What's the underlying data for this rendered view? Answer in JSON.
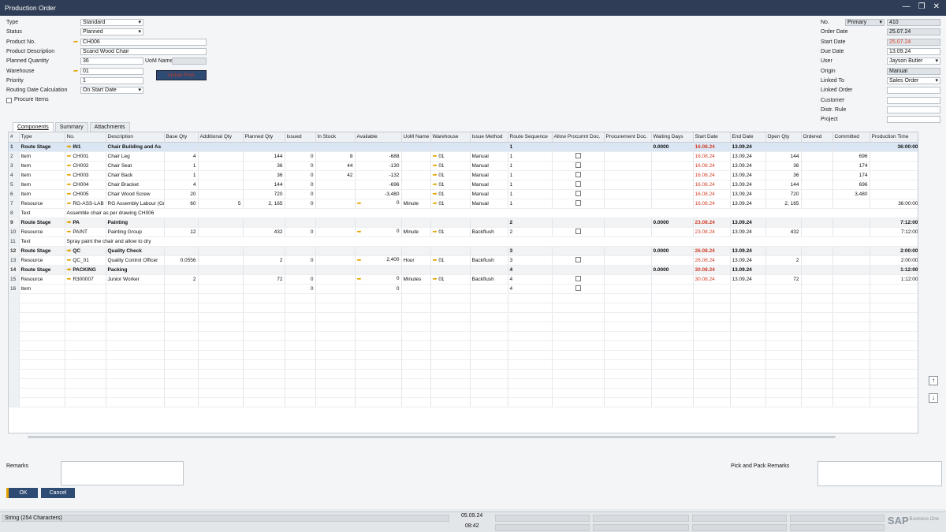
{
  "window": {
    "title": "Production Order"
  },
  "header": {
    "type": {
      "label": "Type",
      "value": "Standard"
    },
    "status": {
      "label": "Status",
      "value": "Planned"
    },
    "product_no": {
      "label": "Product No.",
      "value": "CH006"
    },
    "product_desc": {
      "label": "Product Description",
      "value": "Scand Wood Chair"
    },
    "planned_qty": {
      "label": "Planned Quantity",
      "value": "36"
    },
    "uom_name": {
      "label": "UoM Name",
      "value": ""
    },
    "warehouse": {
      "label": "Warehouse",
      "value": "01"
    },
    "priority": {
      "label": "Priority",
      "value": "1"
    },
    "routing_date": {
      "label": "Routing Date Calculation",
      "value": "On Start Date"
    },
    "procure_items": {
      "label": "Procure Items"
    },
    "red_button": {
      "label": "Update Prod."
    },
    "no": {
      "label": "No.",
      "series": "Primary",
      "value": "410"
    },
    "order_date": {
      "label": "Order Date",
      "value": "25.07.24"
    },
    "start_date": {
      "label": "Start Date",
      "value": "25.07.24"
    },
    "due_date": {
      "label": "Due Date",
      "value": "13.09.24"
    },
    "user": {
      "label": "User",
      "value": "Jayson Butler"
    },
    "origin": {
      "label": "Origin",
      "value": "Manual"
    },
    "linked_to": {
      "label": "Linked To",
      "value": "Sales Order"
    },
    "linked_order": {
      "label": "Linked Order",
      "value": ""
    },
    "customer": {
      "label": "Customer",
      "value": ""
    },
    "distr_rule": {
      "label": "Distr. Rule",
      "value": ""
    },
    "project": {
      "label": "Project",
      "value": ""
    }
  },
  "tabs": [
    "Components",
    "Summary",
    "Attachments"
  ],
  "grid": {
    "columns": [
      "#",
      "Type",
      "No.",
      "Description",
      "Base Qty",
      "Additional Qty",
      "Planned Qty",
      "Issued",
      "In Stock",
      "Available",
      "UoM Name",
      "Warehouse",
      "Issue Method",
      "Route Sequence",
      "Allow Procurmt Doc.",
      "Procurement Doc.",
      "Waiting Days",
      "Start Date",
      "End Date",
      "Open Qty",
      "Ordered",
      "Committed",
      "Production Time"
    ],
    "rows": [
      {
        "n": "1",
        "type": "Route Stage",
        "no": "IN1",
        "desc": "Chair Building and As",
        "base": "",
        "add": "",
        "planned": "",
        "issued": "",
        "stock": "",
        "avail": "",
        "uom": "",
        "wh": "",
        "method": "",
        "seq": "1",
        "allow": false,
        "proc": "",
        "wait": "0.0000",
        "start": "16.08.24",
        "end": "13.09.24",
        "open": "",
        "ordered": "",
        "committed": "",
        "time": "36:00:00",
        "kind": "stage first"
      },
      {
        "n": "2",
        "type": "Item",
        "no": "CH001",
        "desc": "Chair Leg",
        "base": "4",
        "add": "",
        "planned": "144",
        "issued": "0",
        "stock": "8",
        "avail": "-688",
        "uom": "",
        "wh": "01",
        "method": "Manual",
        "seq": "1",
        "allow": true,
        "proc": "",
        "wait": "",
        "start": "16.08.24",
        "end": "13.09.24",
        "open": "144",
        "ordered": "",
        "committed": "696",
        "time": "",
        "kind": "item"
      },
      {
        "n": "3",
        "type": "Item",
        "no": "CH002",
        "desc": "Chair Seat",
        "base": "1",
        "add": "",
        "planned": "36",
        "issued": "0",
        "stock": "44",
        "avail": "-130",
        "uom": "",
        "wh": "01",
        "method": "Manual",
        "seq": "1",
        "allow": true,
        "proc": "",
        "wait": "",
        "start": "16.08.24",
        "end": "13.09.24",
        "open": "36",
        "ordered": "",
        "committed": "174",
        "time": "",
        "kind": "item"
      },
      {
        "n": "4",
        "type": "Item",
        "no": "CH003",
        "desc": "Chair Back",
        "base": "1",
        "add": "",
        "planned": "36",
        "issued": "0",
        "stock": "42",
        "avail": "-132",
        "uom": "",
        "wh": "01",
        "method": "Manual",
        "seq": "1",
        "allow": true,
        "proc": "",
        "wait": "",
        "start": "16.08.24",
        "end": "13.09.24",
        "open": "36",
        "ordered": "",
        "committed": "174",
        "time": "",
        "kind": "item"
      },
      {
        "n": "5",
        "type": "Item",
        "no": "CH004",
        "desc": "Chair Bracket",
        "base": "4",
        "add": "",
        "planned": "144",
        "issued": "0",
        "stock": "",
        "avail": "-696",
        "uom": "",
        "wh": "01",
        "method": "Manual",
        "seq": "1",
        "allow": true,
        "proc": "",
        "wait": "",
        "start": "16.08.24",
        "end": "13.09.24",
        "open": "144",
        "ordered": "",
        "committed": "696",
        "time": "",
        "kind": "item"
      },
      {
        "n": "6",
        "type": "Item",
        "no": "CH005",
        "desc": "Chair Wood Screw",
        "base": "20",
        "add": "",
        "planned": "720",
        "issued": "0",
        "stock": "",
        "avail": "-3,480",
        "uom": "",
        "wh": "01",
        "method": "Manual",
        "seq": "1",
        "allow": true,
        "proc": "",
        "wait": "",
        "start": "16.08.24",
        "end": "13.09.24",
        "open": "720",
        "ordered": "",
        "committed": "3,480",
        "time": "",
        "kind": "item"
      },
      {
        "n": "7",
        "type": "Resource",
        "no": "RG-ASS-LAB",
        "desc": "RG Assembly Labour (Gr",
        "base": "60",
        "add": "5",
        "planned": "2, 165",
        "issued": "0",
        "stock": "",
        "avail": "0",
        "uom": "Minute",
        "wh": "01",
        "method": "Manual",
        "seq": "1",
        "allow": true,
        "proc": "",
        "wait": "",
        "start": "16.08.24",
        "end": "13.09.24",
        "open": "2, 165",
        "ordered": "",
        "committed": "",
        "time": "36:00:00",
        "kind": "res"
      },
      {
        "n": "8",
        "type": "Text",
        "no": "",
        "desc": "Assemble chair as per drawing CH006",
        "kind": "text"
      },
      {
        "n": "9",
        "type": "Route Stage",
        "no": "PA",
        "desc": "Painting",
        "base": "",
        "add": "",
        "planned": "",
        "issued": "",
        "stock": "",
        "avail": "",
        "uom": "",
        "wh": "",
        "method": "",
        "seq": "2",
        "allow": false,
        "proc": "",
        "wait": "0.0000",
        "start": "23.08.24",
        "end": "13.09.24",
        "open": "",
        "ordered": "",
        "committed": "",
        "time": "7:12:00",
        "kind": "stage"
      },
      {
        "n": "10",
        "type": "Resource",
        "no": "PAINT",
        "desc": "Painting Group",
        "base": "12",
        "add": "",
        "planned": "432",
        "issued": "0",
        "stock": "",
        "avail": "0",
        "uom": "Minute",
        "wh": "01",
        "method": "Backflush",
        "seq": "2",
        "allow": false,
        "proc": "",
        "wait": "",
        "start": "23.08.24",
        "end": "13.09.24",
        "open": "432",
        "ordered": "",
        "committed": "",
        "time": "7:12:00",
        "kind": "res"
      },
      {
        "n": "11",
        "type": "Text",
        "no": "",
        "desc": "Spray paint the chair and allow to dry",
        "kind": "text"
      },
      {
        "n": "12",
        "type": "Route Stage",
        "no": "QC",
        "desc": "Quality Check",
        "base": "",
        "add": "",
        "planned": "",
        "issued": "",
        "stock": "",
        "avail": "",
        "uom": "",
        "wh": "",
        "method": "",
        "seq": "3",
        "allow": false,
        "proc": "",
        "wait": "0.0000",
        "start": "26.08.24",
        "end": "13.09.24",
        "open": "",
        "ordered": "",
        "committed": "",
        "time": "2:00:00",
        "kind": "stage"
      },
      {
        "n": "13",
        "type": "Resource",
        "no": "QC_01",
        "desc": "Quality Control Officer",
        "base": "0.0556",
        "add": "",
        "planned": "2",
        "issued": "0",
        "stock": "",
        "avail": "2,400",
        "uom": "Hour",
        "wh": "01",
        "method": "Backflush",
        "seq": "3",
        "allow": false,
        "proc": "",
        "wait": "",
        "start": "26.08.24",
        "end": "13.09.24",
        "open": "2",
        "ordered": "",
        "committed": "",
        "time": "2:00:00",
        "kind": "res"
      },
      {
        "n": "14",
        "type": "Route Stage",
        "no": "PACKING",
        "desc": "Packing",
        "base": "",
        "add": "",
        "planned": "",
        "issued": "",
        "stock": "",
        "avail": "",
        "uom": "",
        "wh": "",
        "method": "",
        "seq": "4",
        "allow": false,
        "proc": "",
        "wait": "0.0000",
        "start": "30.08.24",
        "end": "13.09.24",
        "open": "",
        "ordered": "",
        "committed": "",
        "time": "1:12:00",
        "kind": "stage"
      },
      {
        "n": "15",
        "type": "Resource",
        "no": "R300007",
        "desc": "Junior Worker",
        "base": "2",
        "add": "",
        "planned": "72",
        "issued": "0",
        "stock": "",
        "avail": "0",
        "uom": "Minutes",
        "wh": "01",
        "method": "Backflush",
        "seq": "4",
        "allow": false,
        "proc": "",
        "wait": "",
        "start": "30.08.24",
        "end": "13.09.24",
        "open": "72",
        "ordered": "",
        "committed": "",
        "time": "1:12:00",
        "kind": "res"
      },
      {
        "n": "16",
        "type": "Item",
        "no": "",
        "desc": "",
        "base": "",
        "add": "",
        "planned": "",
        "issued": "0",
        "stock": "",
        "avail": "0",
        "uom": "",
        "wh": "",
        "method": "",
        "seq": "4",
        "allow": true,
        "proc": "",
        "wait": "",
        "start": "",
        "end": "",
        "open": "",
        "ordered": "",
        "committed": "",
        "time": "",
        "kind": "empty"
      }
    ]
  },
  "footer": {
    "remarks_label": "Remarks",
    "pick_label": "Pick and Pack Remarks",
    "ok_label": "OK",
    "cancel_label": "Cancel"
  },
  "statusbar": {
    "text": "String (254 Characters)",
    "date": "05.09.24",
    "time": "08:42",
    "logo": "SAP",
    "logo_small": "Business One"
  }
}
